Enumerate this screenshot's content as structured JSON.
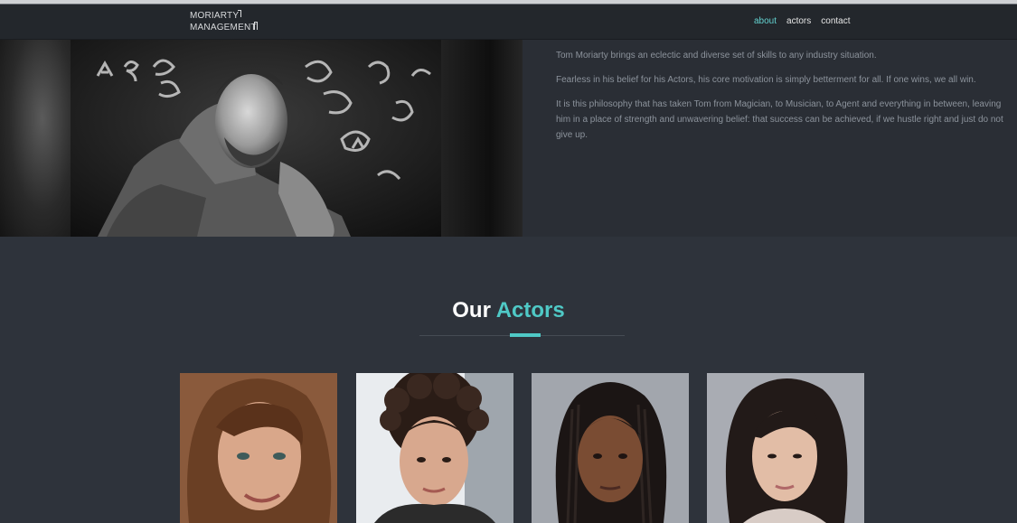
{
  "logo": {
    "line1": "MORIARTY",
    "line2": "MANAGEMENT"
  },
  "nav": {
    "items": [
      {
        "label": "about",
        "active": true
      },
      {
        "label": "actors",
        "active": false
      },
      {
        "label": "contact",
        "active": false
      }
    ]
  },
  "about": {
    "paragraphs": [
      "Tom Moriarty brings an eclectic and diverse set of skills to any industry situation.",
      "Fearless in his belief for his Actors, his core motivation is simply betterment for all. If one wins, we all win.",
      "It is this philosophy that has taken Tom from Magician, to Musician, to Agent and everything in between, leaving him in a place of strength and unwavering belief: that success can be achieved, if we hustle right and just do not give up."
    ]
  },
  "actors": {
    "title_plain": "Our",
    "title_accent": "Actors"
  },
  "colors": {
    "accent": "#4fc9c6",
    "nav_active": "#63d1cf",
    "background": "#2e333b",
    "navbar": "#23272c"
  }
}
